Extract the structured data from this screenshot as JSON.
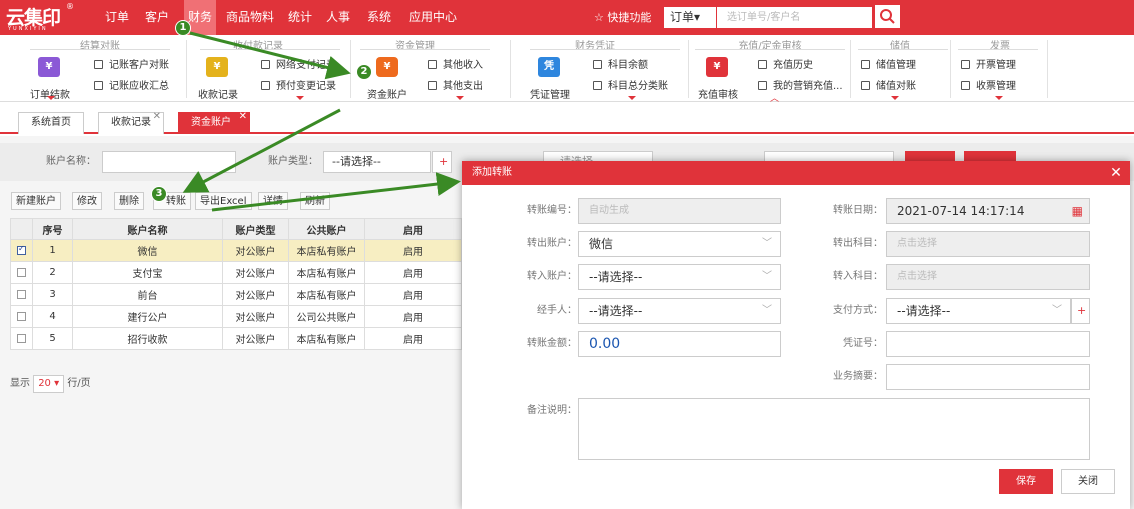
{
  "app": {
    "logo_text": "云集印",
    "logo_sub": "YUNXIYIN",
    "logo_reg": "®"
  },
  "topnav": [
    "订单",
    "客户",
    "财务",
    "商品物料",
    "统计",
    "人事",
    "系统",
    "应用中心"
  ],
  "quick_menu": "☆ 快捷功能",
  "order_select": "订单▾",
  "search_placeholder": "选订单号/客户名",
  "ribbon": {
    "groups": [
      "结算对账",
      "收付款记录",
      "资金管理",
      "财务凭证",
      "充值/定金审核",
      "储值",
      "发票"
    ],
    "big": {
      "order_settle": {
        "label": "订单结款",
        "icon": "¥"
      },
      "receipt_record": {
        "label": "收款记录",
        "icon": "¥"
      },
      "fund_account": {
        "label": "资金账户",
        "icon": "¥"
      },
      "voucher": {
        "label": "凭证管理",
        "icon": "凭"
      },
      "recharge_review": {
        "label": "充值审核",
        "icon": "¥"
      }
    },
    "small": {
      "cust_reconcile": "记账客户对账",
      "receivable_summary": "记账应收汇总",
      "online_pay_record": "网络支付记录",
      "prepay_change": "预付变更记录",
      "other_income": "其他收入",
      "other_expense": "其他支出",
      "subject_balance": "科目余额",
      "subject_ledger": "科目总分类账",
      "recharge_history": "充值历史",
      "my_marketing": "我的营销充值...",
      "stored_manage": "储值管理",
      "stored_reconcile": "储值对账",
      "invoice_manage": "开票管理",
      "receipt_manage": "收票管理"
    }
  },
  "tabs": [
    "系统首页",
    "收款记录",
    "资金账户"
  ],
  "filter": {
    "name_label": "账户名称：",
    "type_label": "账户类型：",
    "type_value": "--请选择--",
    "plus": "+",
    "hidden_select": "--请选择--"
  },
  "toolbar": [
    "新建账户",
    "修改",
    "删除",
    "转账",
    "导出Excel",
    "详情",
    "刷新"
  ],
  "grid": {
    "headers": [
      "序号",
      "账户名称",
      "账户类型",
      "公共账户",
      "启用"
    ],
    "rows": [
      {
        "n": "1",
        "name": "微信",
        "type": "对公账户",
        "pub": "本店私有账户",
        "en": "启用",
        "checked": true
      },
      {
        "n": "2",
        "name": "支付宝",
        "type": "对公账户",
        "pub": "本店私有账户",
        "en": "启用",
        "checked": false
      },
      {
        "n": "3",
        "name": "前台",
        "type": "对公账户",
        "pub": "本店私有账户",
        "en": "启用",
        "checked": false
      },
      {
        "n": "4",
        "name": "建行公户",
        "type": "对公账户",
        "pub": "公司公共账户",
        "en": "启用",
        "checked": false
      },
      {
        "n": "5",
        "name": "招行收款",
        "type": "对公账户",
        "pub": "本店私有账户",
        "en": "启用",
        "checked": false
      }
    ]
  },
  "pager": {
    "show": "显示",
    "size": "20",
    "unit": "行/页"
  },
  "modal": {
    "title": "添加转账",
    "transfer_no_label": "转账编号：",
    "transfer_no_value": "自动生成",
    "date_label": "转账日期：",
    "date_value": "2021-07-14 14:17:14",
    "out_account_label": "转出账户：",
    "out_account_value": "微信",
    "out_subject_label": "转出科目：",
    "out_subject_value": "点击选择",
    "in_account_label": "转入账户：",
    "in_account_value": "--请选择--",
    "in_subject_label": "转入科目：",
    "in_subject_value": "点击选择",
    "handler_label": "经手人：",
    "handler_value": "--请选择--",
    "pay_method_label": "支付方式：",
    "pay_method_value": "--请选择--",
    "amount_label": "转账金额：",
    "amount_value": "0.00",
    "voucher_label": "凭证号：",
    "summary_label": "业务摘要：",
    "remark_label": "备注说明：",
    "save": "保存",
    "close": "关闭"
  },
  "badges": [
    "1",
    "2",
    "3"
  ],
  "colors": {
    "brand_red": "#e0333a",
    "arrow_green": "#3a8a25",
    "selected_row": "#f7eec2",
    "amount_blue": "#1a55b0"
  }
}
